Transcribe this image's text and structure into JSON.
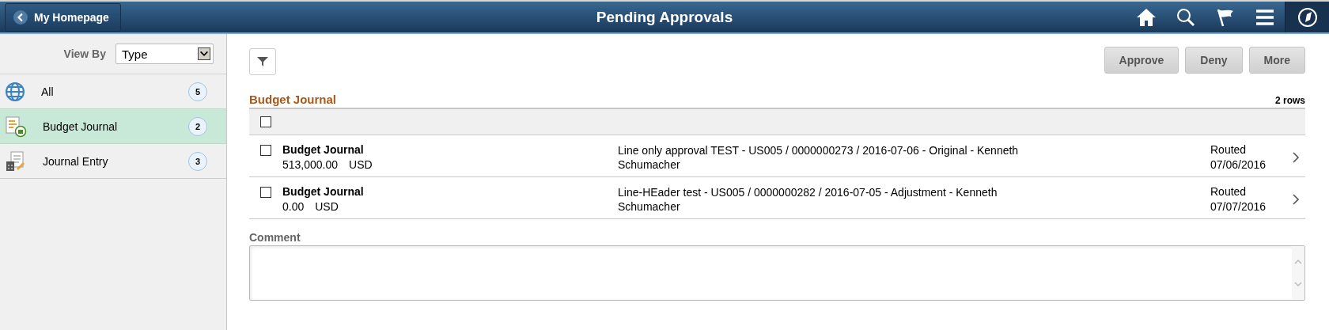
{
  "header": {
    "back_label": "My Homepage",
    "title": "Pending Approvals"
  },
  "sidebar": {
    "view_by": {
      "label": "View By",
      "value": "Type"
    },
    "items": [
      {
        "label": "All",
        "count": "5",
        "selected": false
      },
      {
        "label": "Budget Journal",
        "count": "2",
        "selected": true
      },
      {
        "label": "Journal Entry",
        "count": "3",
        "selected": false
      }
    ]
  },
  "actions": [
    "Approve",
    "Deny",
    "More"
  ],
  "grid": {
    "title": "Budget Journal",
    "row_count": "2 rows",
    "select_all": {
      "checked": false
    },
    "rows": [
      {
        "checked": false,
        "type": "Budget Journal",
        "amount": "513,000.00",
        "currency": "USD",
        "description": "Line only approval TEST - US005 / 0000000273 / 2016-07-06 - Original - Kenneth Schumacher",
        "status": "Routed",
        "date": "07/06/2016"
      },
      {
        "checked": false,
        "type": "Budget Journal",
        "amount": "0.00",
        "currency": "USD",
        "description": "Line-HEader test - US005 / 0000000282 / 2016-07-05 - Adjustment - Kenneth Schumacher",
        "status": "Routed",
        "date": "07/07/2016"
      }
    ]
  },
  "comment": {
    "label": "Comment"
  }
}
